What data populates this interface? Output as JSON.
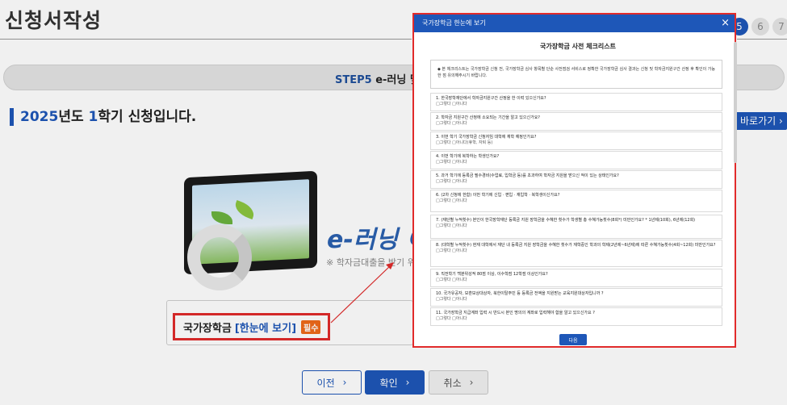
{
  "page": {
    "title": "신청서작성",
    "steps": [
      "5",
      "6",
      "7"
    ],
    "step_banner": {
      "prefix": "STEP5 ",
      "strong": "e-러닝 및"
    },
    "semester_line": {
      "year": "2025",
      "t1": "년도 ",
      "term": "1",
      "t2": "학기 신청입니다."
    },
    "shortcut_label": "바로가기 ›"
  },
  "promo": {
    "elearn_title": "e-러닝 이",
    "elearn_note": "※ 학자금대출을 받기 위해"
  },
  "notice": {
    "label": "국가장학금",
    "link": "[한눈에 보기]",
    "badge": "필수"
  },
  "buttons": {
    "prev": "이전",
    "ok": "확인",
    "cancel": "취소",
    "chevron": "›"
  },
  "modal": {
    "header": "국가장학금 한눈에 보기",
    "close": "×",
    "title": "국가장학금 사전 체크리스트",
    "intro": "◆ 본 체크리스트는 국가장학금 신청 전, 국가장학금 심사 항목별 단순 사전점검 서비스로 정확한 국가장학금 심사 결과는 신청 및 학자금지원구간 산정 후 확인이 가능한 점 유의해주시기 바랍니다.",
    "questions": [
      {
        "q": "1. 한국장학재단에서 학자금지원구간 산정을 한 이력 있으신가요?",
        "o": "□그렇다 □아니다"
      },
      {
        "q": "2. 학자금 지원구간 산정에 소요되는 기간을 알고 있으신가요?",
        "o": "□그렇다 □아니다"
      },
      {
        "q": "3. 이번 학기 국가장학금 신청자임 대학에 재학 예정인가요?",
        "o": "□그렇다 □아니다(휴학, 자퇴 등)"
      },
      {
        "q": "4. 이번 학기에 복학하는 학생인가요?",
        "o": "□그렇다 □아니다"
      },
      {
        "q": "5. 과거 학기에 등록금 필수경비(수업료, 입학금 등)를 초과하여 학자금 지원을 받으신 적이 있는 상태인가요?",
        "o": "□그렇다 □아니다"
      },
      {
        "q": "6. (2차 신청에 한함) 이번 학기에 신입 · 편입 · 재입학 · 복학생이신가요?",
        "o": "□그렇다 □아니다"
      },
      {
        "q": "7. (재단별 누적횟수) 본인이 한국장학재단 등록금 지원 장학금을 수혜한 횟수가 학생별 총 수혜가능횟수(8회*) 미만인가요? * 1년제(10회), 6년제(12회)",
        "o": "□그렇다 □아니다"
      },
      {
        "q": "8. (대학별 누적횟수) 현재 대학에서 재단 내 등록금 지원 장학금을 수혜한 횟수가 재학중인 학과의 학제(2년제~6년제)에 따른 수혜가능횟수(4회~12회) 미만인가요?",
        "o": "□그렇다 □아니다"
      },
      {
        "q": "9. 직전학기 백분위성적 80점 이상, 이수학점 12학점 이상인가요?",
        "o": "□그렇다 □아니다"
      },
      {
        "q": "10. 국가유공자, 보훈보상대상자, 북한이탈주민 등 등록금 전액을 지원받는 교육지원대상자입니까 ?",
        "o": "□그렇다 □아니다"
      },
      {
        "q": "11. 국가장학금 지급계좌 입력 시 반드시 본인 명의의 계좌로 입력해야 함을 알고 있으신가요 ?",
        "o": "□그렇다 □아니다"
      }
    ],
    "next": "다음"
  }
}
